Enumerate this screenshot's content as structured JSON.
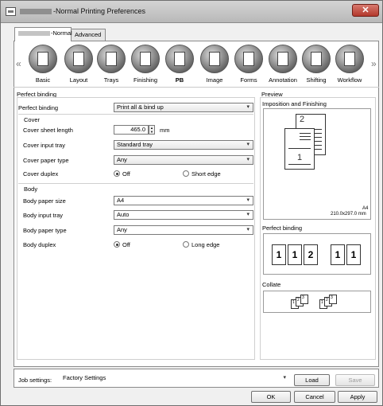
{
  "window": {
    "title": "-Normal Printing Preferences",
    "close_label": "✕"
  },
  "tabs": [
    {
      "label": "-Normal"
    },
    {
      "label": "Advanced"
    }
  ],
  "toolbar": {
    "left_arrow": "«",
    "right_arrow": "»",
    "items": [
      {
        "label": "Basic",
        "icon": "basic-icon"
      },
      {
        "label": "Layout",
        "icon": "layout-icon"
      },
      {
        "label": "Trays",
        "icon": "trays-icon"
      },
      {
        "label": "Finishing",
        "icon": "finishing-icon"
      },
      {
        "label": "PB",
        "icon": "perfect-binding-icon",
        "selected": true
      },
      {
        "label": "Image",
        "icon": "image-icon"
      },
      {
        "label": "Forms",
        "icon": "forms-icon"
      },
      {
        "label": "Annotation",
        "icon": "annotation-icon"
      },
      {
        "label": "Shifting",
        "icon": "shifting-icon"
      },
      {
        "label": "Workflow",
        "icon": "workflow-icon"
      }
    ]
  },
  "perfect_binding": {
    "section_title": "Perfect binding",
    "perfect_binding_label": "Perfect binding",
    "perfect_binding_value": "Print all & bind up",
    "cover_group": "Cover",
    "cover_sheet_length_label": "Cover sheet length",
    "cover_sheet_length_value": "465.0",
    "cover_sheet_length_unit": "mm",
    "cover_input_tray_label": "Cover input tray",
    "cover_input_tray_value": "Standard tray",
    "cover_paper_type_label": "Cover paper type",
    "cover_paper_type_value": "Any",
    "cover_duplex_label": "Cover duplex",
    "cover_duplex_off": "Off",
    "cover_duplex_short": "Short edge",
    "body_group": "Body",
    "body_paper_size_label": "Body paper size",
    "body_paper_size_value": "A4",
    "body_input_tray_label": "Body input tray",
    "body_input_tray_value": "Auto",
    "body_paper_type_label": "Body paper type",
    "body_paper_type_value": "Any",
    "body_duplex_label": "Body duplex",
    "body_duplex_off": "Off",
    "body_duplex_long": "Long edge"
  },
  "preview": {
    "section_title": "Preview",
    "imposition_title": "Imposition and Finishing",
    "paper_size": "A4",
    "paper_dims": "210.0x297.0 mm",
    "page1": "1",
    "page2": "2",
    "perfect_binding_title": "Perfect binding",
    "pb_page_num": "1",
    "pb_back_num": "2",
    "collate_title": "Collate",
    "collate_nums": [
      "1",
      "2",
      "3"
    ]
  },
  "bottom": {
    "job_settings_label": "Job settings:",
    "job_settings_value": "Factory Settings",
    "load_label": "Load",
    "save_label": "Save",
    "ok_label": "OK",
    "cancel_label": "Cancel",
    "apply_label": "Apply"
  }
}
